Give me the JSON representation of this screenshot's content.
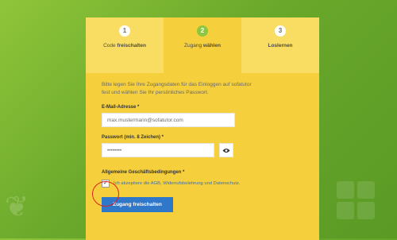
{
  "steps": [
    {
      "number": "1",
      "label_pre": "Code ",
      "label_bold": "freischalten",
      "active": false
    },
    {
      "number": "2",
      "label_pre": "Zugang ",
      "label_bold": "wählen",
      "active": true
    },
    {
      "number": "3",
      "label_pre": "",
      "label_bold": "Loslernen",
      "active": false
    }
  ],
  "form": {
    "intro_line1": "Bitte legen Sie Ihre Zugangsdaten für das Einloggen auf sofatutor",
    "intro_line2": "fest und wählen Sie Ihr persönliches Passwort.",
    "email_label": "E-Mail-Adresse *",
    "email_value": "max.mustermann@sofatutor.com",
    "password_label": "Passwort (min. 8 Zeichen) *",
    "password_value": "••••••••",
    "agb_label": "Allgemeine Geschäftsbedingungen *",
    "agb_text": "Ich akzeptiere die AGB, Widerrufsbelehrung und Datenschutz.",
    "agb_checked": "✓",
    "submit_label": "Zugang freischalten"
  },
  "icons": {
    "password_toggle": "eye-icon",
    "checkbox_mark": "checkmark-icon"
  },
  "colors": {
    "accent_green": "#8dc63f",
    "card_yellow": "#f5cf3c",
    "button_blue": "#2f77c9",
    "highlight_red": "#e02020"
  }
}
